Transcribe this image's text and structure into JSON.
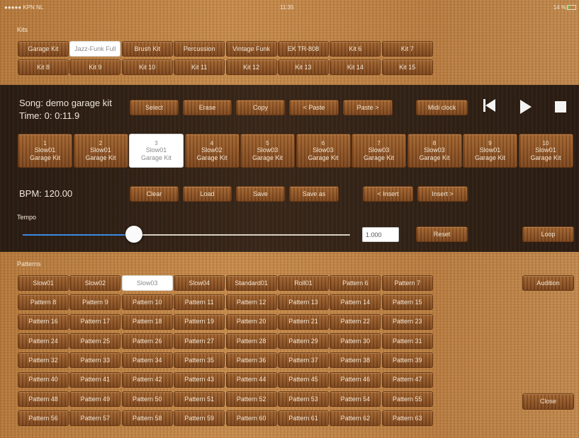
{
  "status_bar": {
    "carrier": "●●●●● KPN NL",
    "time": "11:35",
    "battery": "14 %"
  },
  "kits": {
    "label": "Kits",
    "items": [
      "Garage Kit",
      "Jazz-Funk Full",
      "Brush Kit",
      "Percussion",
      "Vintage Funk",
      "EK TR-808",
      "Kit 6",
      "Kit 7",
      "Kit 8",
      "Kit 9",
      "Kit 10",
      "Kit 11",
      "Kit 12",
      "Kit 13",
      "Kit 14",
      "Kit 15"
    ],
    "selected": "Jazz-Funk Full"
  },
  "song": {
    "name": "Song: demo garage kit",
    "time": "Time:  0: 0:11.9",
    "buttons": {
      "select": "Select",
      "erase": "Erase",
      "copy": "Copy",
      "paste_before": "< Paste",
      "paste_after": "Paste >",
      "midi_clock": "Midi clock"
    }
  },
  "sequence": {
    "items": [
      {
        "num": "1",
        "pattern": "Slow01",
        "kit": "Garage Kit"
      },
      {
        "num": "2",
        "pattern": "Slow01",
        "kit": "Garage Kit"
      },
      {
        "num": "3",
        "pattern": "Slow01",
        "kit": "Garage Kit"
      },
      {
        "num": "4",
        "pattern": "Slow02",
        "kit": "Garage Kit"
      },
      {
        "num": "5",
        "pattern": "Slow03",
        "kit": "Garage Kit"
      },
      {
        "num": "6",
        "pattern": "Slow03",
        "kit": "Garage Kit"
      },
      {
        "num": "7",
        "pattern": "Slow03",
        "kit": "Garage Kit"
      },
      {
        "num": "8",
        "pattern": "Slow03",
        "kit": "Garage Kit"
      },
      {
        "num": "9",
        "pattern": "Slow01",
        "kit": "Garage Kit"
      },
      {
        "num": "10",
        "pattern": "Slow01",
        "kit": "Garage Kit"
      }
    ],
    "selected_index": 2
  },
  "bpm": {
    "label": "BPM: 120.00",
    "buttons": {
      "clear": "Clear",
      "load": "Load",
      "save": "Save",
      "save_as": "Save as",
      "insert_before": "< Insert",
      "insert_after": "Insert >"
    }
  },
  "tempo": {
    "label": "Tempo",
    "value": "1.000",
    "slider_fraction": 0.34,
    "reset": "Reset",
    "loop": "Loop"
  },
  "patterns": {
    "label": "Patterns",
    "items": [
      "Slow01",
      "Slow02",
      "Slow03",
      "Slow04",
      "Standard01",
      "Roll01",
      "Pattern 6",
      "Pattern 7",
      "Pattern 8",
      "Pattern 9",
      "Pattern 10",
      "Pattern 11",
      "Pattern 12",
      "Pattern 13",
      "Pattern 14",
      "Pattern 15",
      "Pattern 16",
      "Pattern 17",
      "Pattern 18",
      "Pattern 19",
      "Pattern 20",
      "Pattern 21",
      "Pattern 22",
      "Pattern 23",
      "Pattern 24",
      "Pattern 25",
      "Pattern 26",
      "Pattern 27",
      "Pattern 28",
      "Pattern 29",
      "Pattern 30",
      "Pattern 31",
      "Pattern 32",
      "Pattern 33",
      "Pattern 34",
      "Pattern 35",
      "Pattern 36",
      "Pattern 37",
      "Pattern 38",
      "Pattern 39",
      "Pattern 40",
      "Pattern 41",
      "Pattern 42",
      "Pattern 43",
      "Pattern 44",
      "Pattern 45",
      "Pattern 46",
      "Pattern 47",
      "Pattern 48",
      "Pattern 49",
      "Pattern 50",
      "Pattern 51",
      "Pattern 52",
      "Pattern 53",
      "Pattern 54",
      "Pattern 55",
      "Pattern 56",
      "Pattern 57",
      "Pattern 58",
      "Pattern 59",
      "Pattern 60",
      "Pattern 61",
      "Pattern 62",
      "Pattern 63"
    ],
    "selected": "Slow03",
    "audition": "Audition",
    "close": "Close"
  },
  "icons": {
    "previous": "skip-to-start-icon",
    "play": "play-icon",
    "stop": "stop-icon"
  }
}
